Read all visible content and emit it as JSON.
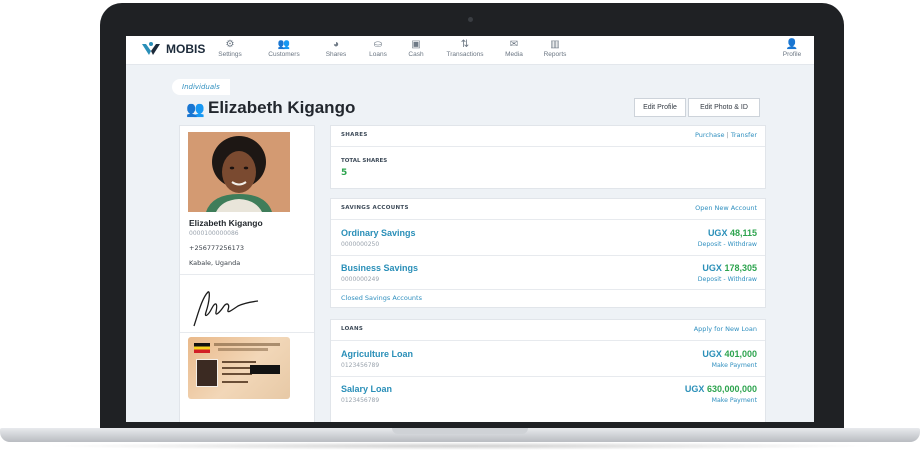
{
  "app": {
    "brand": "MOBIS"
  },
  "nav": {
    "items": [
      {
        "label": "Settings",
        "icon": "gear-icon",
        "glyph": "⚙"
      },
      {
        "label": "Customers",
        "icon": "users-icon",
        "glyph": "👥"
      },
      {
        "label": "Shares",
        "icon": "pie-chart-icon",
        "glyph": "◕"
      },
      {
        "label": "Loans",
        "icon": "coins-icon",
        "glyph": "⛀"
      },
      {
        "label": "Cash",
        "icon": "cash-icon",
        "glyph": "▣"
      },
      {
        "label": "Transactions",
        "icon": "transactions-icon",
        "glyph": "⇅"
      },
      {
        "label": "Media",
        "icon": "media-icon",
        "glyph": "✉"
      },
      {
        "label": "Reports",
        "icon": "reports-icon",
        "glyph": "▥"
      }
    ],
    "profile": {
      "label": "Profile",
      "icon": "user-icon",
      "glyph": "👤"
    }
  },
  "breadcrumb": "Individuals",
  "page": {
    "title": "Elizabeth Kigango",
    "edit_profile": "Edit Profile",
    "edit_photo": "Edit Photo & ID"
  },
  "profile": {
    "name": "Elizabeth Kigango",
    "id": "0000100000086",
    "phone": "+256777256173",
    "location": "Kabale, Uganda"
  },
  "shares": {
    "title": "SHARES",
    "purchase": "Purchase",
    "divider": "|",
    "transfer": "Transfer",
    "total_label": "TOTAL SHARES",
    "total_value": "5"
  },
  "savings": {
    "title": "SAVINGS ACCOUNTS",
    "open_link": "Open New Account",
    "accounts": [
      {
        "name": "Ordinary Savings",
        "number": "0000000250",
        "currency": "UGX",
        "amount": "48,115",
        "actions": "Deposit - Withdraw"
      },
      {
        "name": "Business Savings",
        "number": "0000000249",
        "currency": "UGX",
        "amount": "178,305",
        "actions": "Deposit - Withdraw"
      }
    ],
    "closed_link": "Closed Savings Accounts"
  },
  "loans": {
    "title": "LOANS",
    "apply_link": "Apply for New Loan",
    "items": [
      {
        "name": "Agriculture Loan",
        "number": "0123456789",
        "currency": "UGX",
        "amount": "401,000",
        "action": "Make Payment"
      },
      {
        "name": "Salary Loan",
        "number": "0123456789",
        "currency": "UGX",
        "amount": "630,000,000",
        "action": "Make Payment"
      }
    ]
  },
  "colors": {
    "accent": "#2a8fb8",
    "amount_green": "#2ea44f",
    "laptop": "#1f2124"
  }
}
